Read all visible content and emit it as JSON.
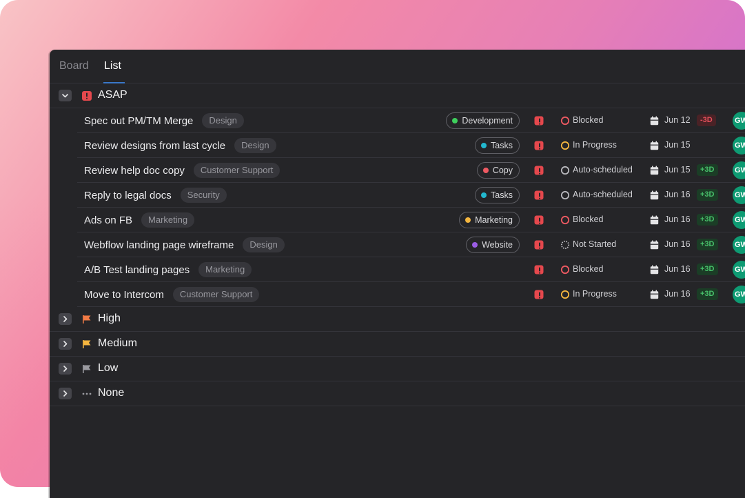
{
  "tabs": [
    {
      "label": "Board",
      "active": false
    },
    {
      "label": "List",
      "active": true
    }
  ],
  "colors": {
    "panel_bg": "#252528",
    "accent_tab": "#3a78c9",
    "asap_red": "#e5484d",
    "high_orange": "#f07a45",
    "medium_yellow": "#f5b63f",
    "low_gray": "#9a9aa0",
    "avatar_green": "#0e9b73"
  },
  "groups": [
    {
      "label": "ASAP",
      "expanded": true,
      "icon": "alert-square-icon"
    },
    {
      "label": "High",
      "expanded": false,
      "icon": "flag-icon"
    },
    {
      "label": "Medium",
      "expanded": false,
      "icon": "flag-icon"
    },
    {
      "label": "Low",
      "expanded": false,
      "icon": "flag-icon"
    },
    {
      "label": "None",
      "expanded": false,
      "icon": "dots-icon"
    }
  ],
  "tasks": [
    {
      "name": "Spec out PM/TM Merge",
      "category": "Design",
      "project": "Development",
      "project_color": "#3ecf5c",
      "status": "Blocked",
      "status_kind": "blocked",
      "date": "Jun 12",
      "delta": "-3D",
      "delta_kind": "neg",
      "assignee": "GW"
    },
    {
      "name": "Review designs from last cycle",
      "category": "Design",
      "project": "Tasks",
      "project_color": "#22b8cf",
      "status": "In Progress",
      "status_kind": "progress",
      "date": "Jun 15",
      "delta": "",
      "delta_kind": "",
      "assignee": "GW"
    },
    {
      "name": "Review help doc copy",
      "category": "Customer Support",
      "project": "Copy",
      "project_color": "#ef5a62",
      "status": "Auto-scheduled",
      "status_kind": "auto",
      "date": "Jun 15",
      "delta": "+3D",
      "delta_kind": "pos",
      "assignee": "GW"
    },
    {
      "name": "Reply to legal docs",
      "category": "Security",
      "project": "Tasks",
      "project_color": "#22b8cf",
      "status": "Auto-scheduled",
      "status_kind": "auto",
      "date": "Jun 16",
      "delta": "+3D",
      "delta_kind": "pos",
      "assignee": "GW"
    },
    {
      "name": "Ads on FB",
      "category": "Marketing",
      "project": "Marketing",
      "project_color": "#f5b63f",
      "status": "Blocked",
      "status_kind": "blocked",
      "date": "Jun 16",
      "delta": "+3D",
      "delta_kind": "pos",
      "assignee": "GW"
    },
    {
      "name": "Webflow landing page wireframe",
      "category": "Design",
      "project": "Website",
      "project_color": "#9b5de5",
      "status": "Not Started",
      "status_kind": "notstarted",
      "date": "Jun 16",
      "delta": "+3D",
      "delta_kind": "pos",
      "assignee": "GW"
    },
    {
      "name": "A/B Test landing pages",
      "category": "Marketing",
      "project": "",
      "project_color": "",
      "status": "Blocked",
      "status_kind": "blocked",
      "date": "Jun 16",
      "delta": "+3D",
      "delta_kind": "pos",
      "assignee": "GW"
    },
    {
      "name": "Move to Intercom",
      "category": "Customer Support",
      "project": "",
      "project_color": "",
      "status": "In Progress",
      "status_kind": "progress",
      "date": "Jun 16",
      "delta": "+3D",
      "delta_kind": "pos",
      "assignee": "GW"
    }
  ]
}
